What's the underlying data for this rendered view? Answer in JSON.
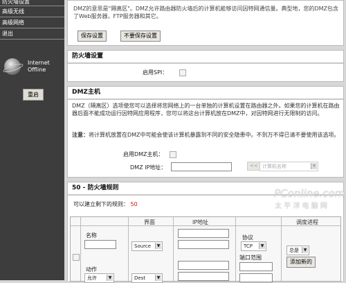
{
  "sidebar": {
    "items": [
      "防火墙设置",
      "高级无线",
      "高级网络",
      "退出"
    ],
    "status_line1": "Internet",
    "status_line2": "Offline",
    "reboot_label": "重启"
  },
  "dmz_intro": {
    "text": "DMZ的意思是\"隔离区\"。DMZ允许路由器防火墙后的计算机能够访问因特网通信量。典型地，您的DMZ包含了Web服务器，FTP服务器和其它。",
    "save_label": "保存设置",
    "nosave_label": "不要保存设置"
  },
  "firewall": {
    "title": "防火墙设置",
    "spi_label": "启用SPI："
  },
  "dmz_host": {
    "title": "DMZ主机",
    "desc": "DMZ（隔离区）选项使您可以选择将您网络上的一台单独的计算机设置在路由器之外。如果您的计算机在路由器后面不能成功运行因特网应用程序，您可以将这台计算机放在DMZ中，对因特网进行无限制的访问。",
    "note_label": "注意：",
    "note_text": "将计算机放置在DMZ中可能会使该计算机暴露到不同的安全隐患中。不到万不得已请不要使用该选项。",
    "enable_label": "启用DMZ主机：",
    "ip_label": "DMZ IP地址：",
    "copy_btn": "<<",
    "computer_name_placeholder": "计算机名称"
  },
  "rules": {
    "title": "50 - 防火墙规则",
    "remaining_label": "可以建立剩下的规则：",
    "remaining_value": "50",
    "col_interface": "界面",
    "col_ip": "IP地址",
    "col_schedule": "调度进程",
    "name_label": "名称",
    "action_label": "动作",
    "action_value": "允许",
    "source_value": "Source",
    "dest_value": "Dest",
    "protocol_label": "协议",
    "protocol_value": "TCP",
    "port_range_label": "端口范围",
    "schedule_value": "总是",
    "add_new_label": "添加新的"
  },
  "watermark": {
    "line1": "PConline.com.cn",
    "line2": "太 平 洋 电 脑 网"
  }
}
